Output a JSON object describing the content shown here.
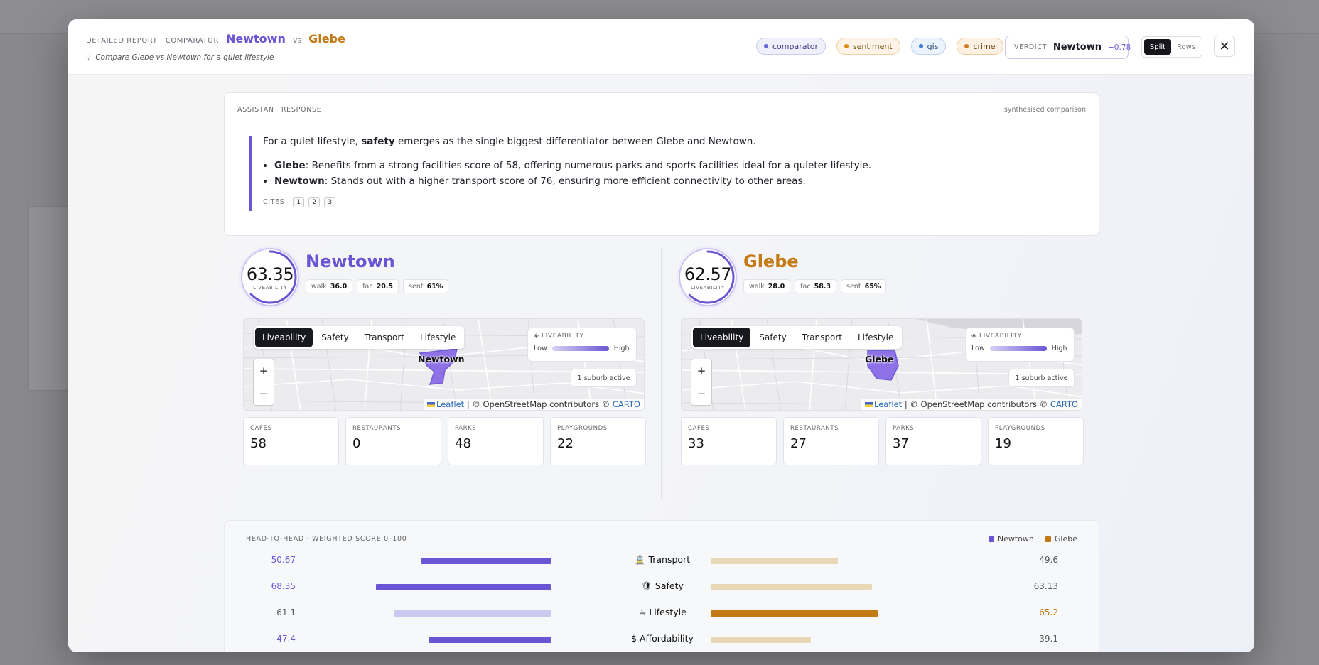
{
  "header": {
    "crumb_label": "DETAILED REPORT · COMPARATOR",
    "suburb_a": "Newtown",
    "vs": "vs",
    "suburb_b": "Glebe",
    "query": "Compare Glebe vs Newtown for a quiet lifestyle",
    "chips": [
      "comparator",
      "sentiment",
      "gis",
      "crime"
    ],
    "verdict_label": "VERDICT",
    "verdict_winner": "Newtown",
    "verdict_delta": "+0.78",
    "view_split": "Split",
    "view_rows": "Rows",
    "close": "✕"
  },
  "response": {
    "label": "ASSISTANT RESPONSE",
    "tag": "synthesised comparison",
    "intro_pre": "For a quiet lifestyle,",
    "intro_bold": "safety",
    "intro_post": "emerges as the single biggest differentiator between Glebe and Newtown.",
    "bullets": [
      {
        "name": "Glebe",
        "text": ": Benefits from a strong facilities score of 58, offering numerous parks and sports facilities ideal for a quieter lifestyle."
      },
      {
        "name": "Newtown",
        "text": ": Stands out with a higher transport score of 76, ensuring more efficient connectivity to other areas."
      }
    ],
    "cites_label": "CITES",
    "cites": [
      "1",
      "2",
      "3"
    ]
  },
  "colors": {
    "newtown": "#6a55d4",
    "glebe": "#c47a14",
    "newtown_light": "#cdc8f0",
    "glebe_light": "#ead7b8"
  },
  "suburbs": [
    {
      "name": "Newtown",
      "score": "63.35",
      "score_fraction": 0.6335,
      "score_label": "LIVEABILITY",
      "walk_label": "walk",
      "walk": "36.0",
      "fac_label": "fac",
      "fac": "20.5",
      "sent_label": "sent",
      "sent": "61%",
      "map": {
        "tabs": [
          "Liveability",
          "Safety",
          "Transport",
          "Lifestyle"
        ],
        "legend_title": "LIVEABILITY",
        "legend_low": "Low",
        "legend_high": "High",
        "active": "1 suburb active",
        "zoom_in": "+",
        "zoom_out": "−",
        "attr_leaflet": "Leaflet",
        "attr_osm": " | © OpenStreetMap contributors © ",
        "attr_carto": "CARTO",
        "label": "Newtown"
      },
      "cards": [
        {
          "label": "CAFES",
          "value": "58"
        },
        {
          "label": "RESTAURANTS",
          "value": "0"
        },
        {
          "label": "PARKS",
          "value": "48"
        },
        {
          "label": "PLAYGROUNDS",
          "value": "22"
        }
      ]
    },
    {
      "name": "Glebe",
      "score": "62.57",
      "score_fraction": 0.6257,
      "score_label": "LIVEABILITY",
      "walk_label": "walk",
      "walk": "28.0",
      "fac_label": "fac",
      "fac": "58.3",
      "sent_label": "sent",
      "sent": "65%",
      "map": {
        "tabs": [
          "Liveability",
          "Safety",
          "Transport",
          "Lifestyle"
        ],
        "legend_title": "LIVEABILITY",
        "legend_low": "Low",
        "legend_high": "High",
        "active": "1 suburb active",
        "zoom_in": "+",
        "zoom_out": "−",
        "attr_leaflet": "Leaflet",
        "attr_osm": " | © OpenStreetMap contributors © ",
        "attr_carto": "CARTO",
        "label": "Glebe"
      },
      "cards": [
        {
          "label": "CAFES",
          "value": "33"
        },
        {
          "label": "RESTAURANTS",
          "value": "27"
        },
        {
          "label": "PARKS",
          "value": "37"
        },
        {
          "label": "PLAYGROUNDS",
          "value": "19"
        }
      ]
    }
  ],
  "head_to_head": {
    "title": "HEAD-TO-HEAD · WEIGHTED SCORE 0–100",
    "legend": [
      "Newtown",
      "Glebe"
    ],
    "max": 100,
    "rows": [
      {
        "icon": "🚊",
        "icon_name": "tram-icon",
        "label": "Transport",
        "a": 50.67,
        "b": 49.6,
        "a_text": "50.67",
        "b_text": "49.6",
        "winner": "a"
      },
      {
        "icon": "🛡",
        "icon_name": "shield-icon",
        "label": "Safety",
        "a": 68.35,
        "b": 63.13,
        "a_text": "68.35",
        "b_text": "63.13",
        "winner": "a"
      },
      {
        "icon": "☕",
        "icon_name": "coffee-icon",
        "label": "Lifestyle",
        "a": 61.1,
        "b": 65.2,
        "a_text": "61.1",
        "b_text": "65.2",
        "winner": "b"
      },
      {
        "icon": "$",
        "icon_name": "dollar-icon",
        "label": "Affordability",
        "a": 47.4,
        "b": 39.1,
        "a_text": "47.4",
        "b_text": "39.1",
        "winner": "a"
      }
    ]
  }
}
